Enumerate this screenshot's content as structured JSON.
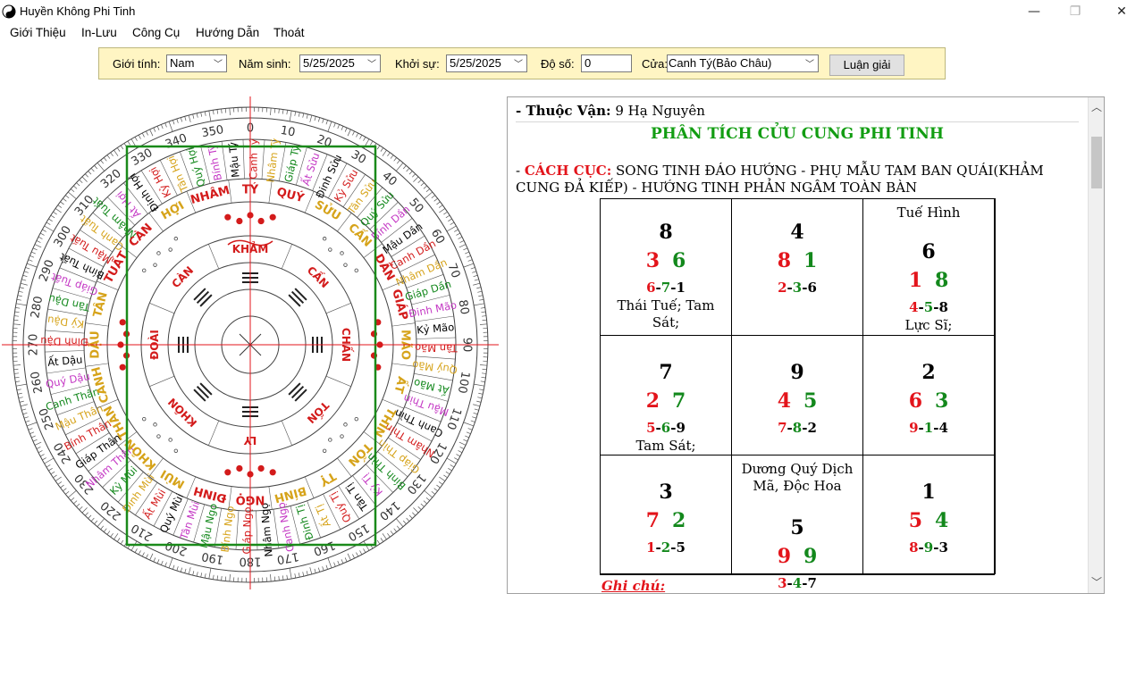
{
  "window": {
    "title": "Huyền Không Phi Tinh",
    "minimize": "—",
    "maximize": "❐",
    "close": "✕"
  },
  "menu": [
    "Giới Thiệu",
    "In-Lưu",
    "Công Cụ",
    "Hướng Dẫn",
    "Thoát"
  ],
  "toolbar": {
    "gender_label": "Giới tính:",
    "gender_value": "Nam",
    "birth_label": "Năm sinh:",
    "birth_value": "5/25/2025",
    "start_label": "Khởi sự:",
    "start_value": "5/25/2025",
    "degree_label": "Độ số:",
    "degree_value": "0",
    "door_label": "Cửa:",
    "door_value": "Canh Tý(Bảo Châu)",
    "analyze_button": "Luận giải"
  },
  "compass": {
    "degree_labels": [
      "0",
      "10",
      "20",
      "30",
      "40",
      "50",
      "60",
      "70",
      "80",
      "90",
      "100",
      "110",
      "120",
      "130",
      "140",
      "150",
      "160",
      "170",
      "180",
      "190",
      "200",
      "210",
      "220",
      "230",
      "240",
      "250",
      "260",
      "270",
      "280",
      "290",
      "300",
      "310",
      "320",
      "330",
      "340",
      "350"
    ],
    "mountains": [
      {
        "name": "NHÂM",
        "color": "#d31b1b"
      },
      {
        "name": "TÝ",
        "color": "#d31b1b"
      },
      {
        "name": "QUÝ",
        "color": "#d31b1b"
      },
      {
        "name": "SỬU",
        "color": "#d6a31a"
      },
      {
        "name": "CẤN",
        "color": "#d6a31a"
      },
      {
        "name": "DẦN",
        "color": "#d31b1b"
      },
      {
        "name": "GIÁP",
        "color": "#d31b1b"
      },
      {
        "name": "MÃO",
        "color": "#d6a31a"
      },
      {
        "name": "ẤT",
        "color": "#d6a31a"
      },
      {
        "name": "THÌN",
        "color": "#d6a31a"
      },
      {
        "name": "TỐN",
        "color": "#d6a31a"
      },
      {
        "name": "TỴ",
        "color": "#d6a31a"
      },
      {
        "name": "BÍNH",
        "color": "#d6a31a"
      },
      {
        "name": "NGỌ",
        "color": "#d31b1b"
      },
      {
        "name": "ĐINH",
        "color": "#d31b1b"
      },
      {
        "name": "MÙI",
        "color": "#d6a31a"
      },
      {
        "name": "KHÔN",
        "color": "#d6a31a"
      },
      {
        "name": "THÂN",
        "color": "#d6a31a"
      },
      {
        "name": "CANH",
        "color": "#d6a31a"
      },
      {
        "name": "DẬU",
        "color": "#d6a31a"
      },
      {
        "name": "TÂN",
        "color": "#d6a31a"
      },
      {
        "name": "TUẤT",
        "color": "#d31b1b"
      },
      {
        "name": "CÀN",
        "color": "#d31b1b"
      },
      {
        "name": "HỢI",
        "color": "#d6a31a"
      }
    ],
    "trigrams": [
      {
        "name": "KHẢM",
        "color": "#d31b1b"
      },
      {
        "name": "CẤN",
        "color": "#d31b1b"
      },
      {
        "name": "CHẤN",
        "color": "#d31b1b"
      },
      {
        "name": "TỐN",
        "color": "#d31b1b"
      },
      {
        "name": "LY",
        "color": "#d31b1b"
      },
      {
        "name": "KHÔN",
        "color": "#d31b1b"
      },
      {
        "name": "ĐOÀI",
        "color": "#d31b1b"
      },
      {
        "name": "CÀN",
        "color": "#d31b1b"
      }
    ],
    "sixty": [
      "Ất Sửu",
      "Đinh Sửu",
      "Kỷ Sửu",
      "Tân Sửu",
      "Quý Sửu",
      "Bính Dần",
      "Mậu Dần",
      "Canh Dần",
      "Nhâm Dần",
      "Giáp Dần",
      "Đinh Mão",
      "Kỷ Mão",
      "Tân Mão",
      "Quý Mão",
      "Ất Mão",
      "Mậu Thìn",
      "Canh Thìn",
      "Nhâm Thìn",
      "Giáp Thìn",
      "Bính Thìn",
      "Kỷ Tị",
      "Tân Tị",
      "Quý Tị",
      "Ất Tị",
      "Đinh Tị",
      "Canh Ngọ",
      "Nhâm Ngọ",
      "Giáp Ngọ",
      "Bính Ngọ",
      "Mậu Ngọ",
      "Tân Mùi",
      "Quý Mùi",
      "Ất Mùi",
      "Đinh Mùi",
      "Kỷ Mùi",
      "Nhâm Thân",
      "Giáp Thân",
      "Bính Thân",
      "Mậu Thân",
      "Canh Thân",
      "Quý Dậu",
      "Ất Dậu",
      "Đinh Dậu",
      "Kỷ Dậu",
      "Tân Dậu",
      "Giáp Tuất",
      "Bính Tuất",
      "Mậu Tuất",
      "Canh Tuất",
      "Nhâm Tuất",
      "Ất Hợi",
      "Đinh Hợi",
      "Kỷ Hợi",
      "Tân Hợi",
      "Quý Hợi",
      "Bính Tý",
      "Mậu Tý",
      "Canh Tý",
      "Nhâm Tý",
      "Giáp Tý"
    ],
    "sixty_colors": [
      "#c437c4",
      "#000000",
      "#d31b1b",
      "#d6a31a",
      "#13881c"
    ]
  },
  "panel": {
    "line_top_label": "- Thuộc Vận:",
    "line_top_value": " 9 Hạ Nguyên",
    "heading": "PHÂN TÍCH CỬU CUNG PHI TINH",
    "cach_dash": "- ",
    "cach_label": "CÁCH CỤC:",
    "cach_text": " SONG TINH ĐÁO HƯỚNG - PHỤ MẪU TAM BAN QUÁI(KHẢM CUNG ĐẢ KIẾP) - HƯỚNG TINH PHẢN NGÂM TOÀN BÀN",
    "ghi_chu": "Ghi chú:",
    "cells": [
      {
        "star": "8",
        "left": "3",
        "right": "6",
        "tri": [
          "6",
          "7",
          "1"
        ],
        "note": "Thái Tuế; Tam Sát;",
        "top_note": ""
      },
      {
        "star": "4",
        "left": "8",
        "right": "1",
        "tri": [
          "2",
          "3",
          "6"
        ],
        "note": "",
        "top_note": ""
      },
      {
        "star": "6",
        "left": "1",
        "right": "8",
        "tri": [
          "4",
          "5",
          "8"
        ],
        "note": "Lực Sĩ;",
        "top_note": "Tuế Hình"
      },
      {
        "star": "7",
        "left": "2",
        "right": "7",
        "tri": [
          "5",
          "6",
          "9"
        ],
        "note": "Tam Sát;",
        "top_note": ""
      },
      {
        "star": "9",
        "left": "4",
        "right": "5",
        "tri": [
          "7",
          "8",
          "2"
        ],
        "note": "",
        "top_note": ""
      },
      {
        "star": "2",
        "left": "6",
        "right": "3",
        "tri": [
          "9",
          "1",
          "4"
        ],
        "note": "",
        "top_note": ""
      },
      {
        "star": "3",
        "left": "7",
        "right": "2",
        "tri": [
          "1",
          "2",
          "5"
        ],
        "note": "",
        "top_note": ""
      },
      {
        "star": "5",
        "left": "9",
        "right": "9",
        "tri": [
          "3",
          "4",
          "7"
        ],
        "note": "",
        "top_note": "Dương Quý Dịch Mã, Độc Hoa"
      },
      {
        "star": "1",
        "left": "5",
        "right": "4",
        "tri": [
          "8",
          "9",
          "3"
        ],
        "note": "",
        "top_note": ""
      }
    ]
  }
}
